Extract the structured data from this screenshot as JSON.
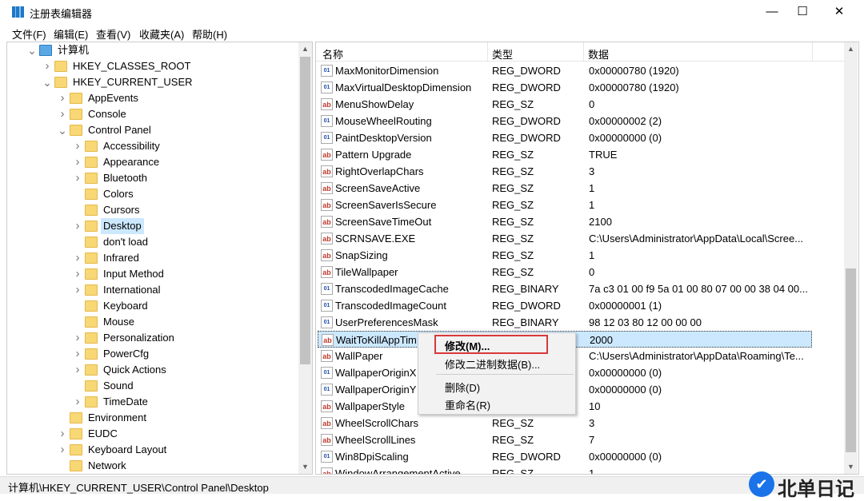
{
  "window": {
    "title": "注册表编辑器",
    "minimize": "—",
    "maximize": "☐",
    "close": "✕"
  },
  "menu": [
    "文件(F)",
    "编辑(E)",
    "查看(V)",
    "收藏夹(A)",
    "帮助(H)"
  ],
  "tree": [
    {
      "label": "计算机",
      "level": 0,
      "expander": "open",
      "icon": "computer"
    },
    {
      "label": "HKEY_CLASSES_ROOT",
      "level": 1,
      "expander": "closed"
    },
    {
      "label": "HKEY_CURRENT_USER",
      "level": 1,
      "expander": "open"
    },
    {
      "label": "AppEvents",
      "level": 2,
      "expander": "closed"
    },
    {
      "label": "Console",
      "level": 2,
      "expander": "closed"
    },
    {
      "label": "Control Panel",
      "level": 2,
      "expander": "open"
    },
    {
      "label": "Accessibility",
      "level": 3,
      "expander": "closed"
    },
    {
      "label": "Appearance",
      "level": 3,
      "expander": "closed"
    },
    {
      "label": "Bluetooth",
      "level": 3,
      "expander": "closed"
    },
    {
      "label": "Colors",
      "level": 3,
      "expander": "none"
    },
    {
      "label": "Cursors",
      "level": 3,
      "expander": "none"
    },
    {
      "label": "Desktop",
      "level": 3,
      "expander": "closed",
      "selected": true
    },
    {
      "label": "don't load",
      "level": 3,
      "expander": "none"
    },
    {
      "label": "Infrared",
      "level": 3,
      "expander": "closed"
    },
    {
      "label": "Input Method",
      "level": 3,
      "expander": "closed"
    },
    {
      "label": "International",
      "level": 3,
      "expander": "closed"
    },
    {
      "label": "Keyboard",
      "level": 3,
      "expander": "none"
    },
    {
      "label": "Mouse",
      "level": 3,
      "expander": "none"
    },
    {
      "label": "Personalization",
      "level": 3,
      "expander": "closed"
    },
    {
      "label": "PowerCfg",
      "level": 3,
      "expander": "closed"
    },
    {
      "label": "Quick Actions",
      "level": 3,
      "expander": "closed"
    },
    {
      "label": "Sound",
      "level": 3,
      "expander": "none"
    },
    {
      "label": "TimeDate",
      "level": 3,
      "expander": "closed"
    },
    {
      "label": "Environment",
      "level": 2,
      "expander": "none"
    },
    {
      "label": "EUDC",
      "level": 2,
      "expander": "closed"
    },
    {
      "label": "Keyboard Layout",
      "level": 2,
      "expander": "closed"
    },
    {
      "label": "Network",
      "level": 2,
      "expander": "none"
    }
  ],
  "columns": {
    "name": "名称",
    "type": "类型",
    "data": "数据"
  },
  "values": [
    {
      "name": "MaxMonitorDimension",
      "type": "REG_DWORD",
      "data": "0x00000780 (1920)"
    },
    {
      "name": "MaxVirtualDesktopDimension",
      "type": "REG_DWORD",
      "data": "0x00000780 (1920)"
    },
    {
      "name": "MenuShowDelay",
      "type": "REG_SZ",
      "data": "0"
    },
    {
      "name": "MouseWheelRouting",
      "type": "REG_DWORD",
      "data": "0x00000002 (2)"
    },
    {
      "name": "PaintDesktopVersion",
      "type": "REG_DWORD",
      "data": "0x00000000 (0)"
    },
    {
      "name": "Pattern Upgrade",
      "type": "REG_SZ",
      "data": "TRUE"
    },
    {
      "name": "RightOverlapChars",
      "type": "REG_SZ",
      "data": "3"
    },
    {
      "name": "ScreenSaveActive",
      "type": "REG_SZ",
      "data": "1"
    },
    {
      "name": "ScreenSaverIsSecure",
      "type": "REG_SZ",
      "data": "1"
    },
    {
      "name": "ScreenSaveTimeOut",
      "type": "REG_SZ",
      "data": "2100"
    },
    {
      "name": "SCRNSAVE.EXE",
      "type": "REG_SZ",
      "data": "C:\\Users\\Administrator\\AppData\\Local\\Scree..."
    },
    {
      "name": "SnapSizing",
      "type": "REG_SZ",
      "data": "1"
    },
    {
      "name": "TileWallpaper",
      "type": "REG_SZ",
      "data": "0"
    },
    {
      "name": "TranscodedImageCache",
      "type": "REG_BINARY",
      "data": "7a c3 01 00 f9 5a 01 00 80 07 00 00 38 04 00..."
    },
    {
      "name": "TranscodedImageCount",
      "type": "REG_DWORD",
      "data": "0x00000001 (1)"
    },
    {
      "name": "UserPreferencesMask",
      "type": "REG_BINARY",
      "data": "98 12 03 80 12 00 00 00"
    },
    {
      "name": "WaitToKillAppTim",
      "type": "",
      "data": "2000",
      "selected": true
    },
    {
      "name": "WallPaper",
      "type": "",
      "data": "C:\\Users\\Administrator\\AppData\\Roaming\\Te..."
    },
    {
      "name": "WallpaperOriginX",
      "type": "",
      "data": "0x00000000 (0)"
    },
    {
      "name": "WallpaperOriginY",
      "type": "",
      "data": "0x00000000 (0)"
    },
    {
      "name": "WallpaperStyle",
      "type": "",
      "data": "10"
    },
    {
      "name": "WheelScrollChars",
      "type": "REG_SZ",
      "data": "3"
    },
    {
      "name": "WheelScrollLines",
      "type": "REG_SZ",
      "data": "7"
    },
    {
      "name": "Win8DpiScaling",
      "type": "REG_DWORD",
      "data": "0x00000000 (0)"
    },
    {
      "name": "WindowArrangementActive",
      "type": "REG_SZ",
      "data": "1"
    }
  ],
  "value_icons": [
    "bin",
    "bin",
    "sz",
    "bin",
    "bin",
    "sz",
    "sz",
    "sz",
    "sz",
    "sz",
    "sz",
    "sz",
    "sz",
    "bin",
    "bin",
    "bin",
    "sz",
    "sz",
    "bin",
    "bin",
    "sz",
    "sz",
    "sz",
    "bin",
    "sz"
  ],
  "context_menu": {
    "modify": "修改(M)...",
    "modify_binary": "修改二进制数据(B)...",
    "delete": "删除(D)",
    "rename": "重命名(R)"
  },
  "status": "计算机\\HKEY_CURRENT_USER\\Control Panel\\Desktop",
  "watermark": "北单日记",
  "highlight_color": "#d9383a"
}
